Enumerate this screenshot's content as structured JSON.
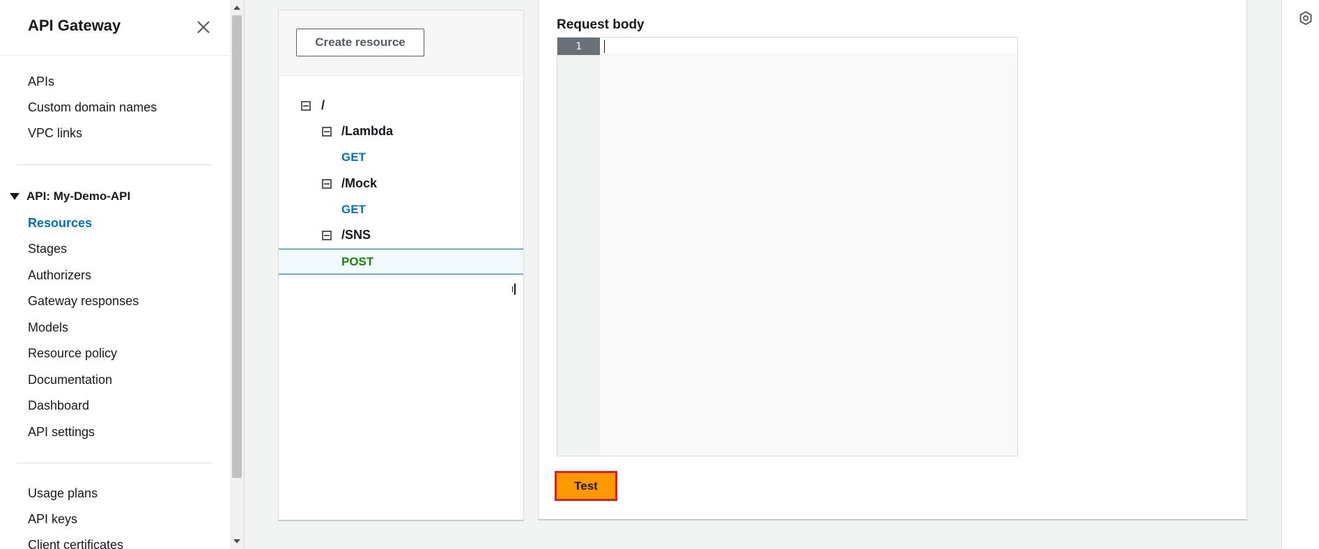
{
  "sidebar": {
    "title": "API Gateway",
    "top_links": [
      "APIs",
      "Custom domain names",
      "VPC links"
    ],
    "section_title": "API: My-Demo-API",
    "section_items": [
      "Resources",
      "Stages",
      "Authorizers",
      "Gateway responses",
      "Models",
      "Resource policy",
      "Documentation",
      "Dashboard",
      "API settings"
    ],
    "bottom_links": [
      "Usage plans",
      "API keys",
      "Client certificates"
    ],
    "active_item": "Resources"
  },
  "resources": {
    "create_button": "Create resource",
    "tree": [
      {
        "type": "resource",
        "path": "/"
      },
      {
        "type": "resource",
        "path": "/Lambda"
      },
      {
        "type": "method",
        "name": "GET"
      },
      {
        "type": "resource",
        "path": "/Mock"
      },
      {
        "type": "method",
        "name": "GET"
      },
      {
        "type": "resource",
        "path": "/SNS"
      },
      {
        "type": "method",
        "name": "POST",
        "selected": true
      }
    ]
  },
  "test": {
    "request_body_label": "Request body",
    "editor_line_number": "1",
    "test_button": "Test"
  },
  "colors": {
    "accent": "#0073bb",
    "post": "#1d8102",
    "test_button": "#ff9900",
    "highlight_border": "#e02020"
  },
  "icons": {
    "close": "close-icon",
    "collapse": "minus-square-icon",
    "caret": "caret-down-icon",
    "rail": "hexagon-settings-icon"
  }
}
